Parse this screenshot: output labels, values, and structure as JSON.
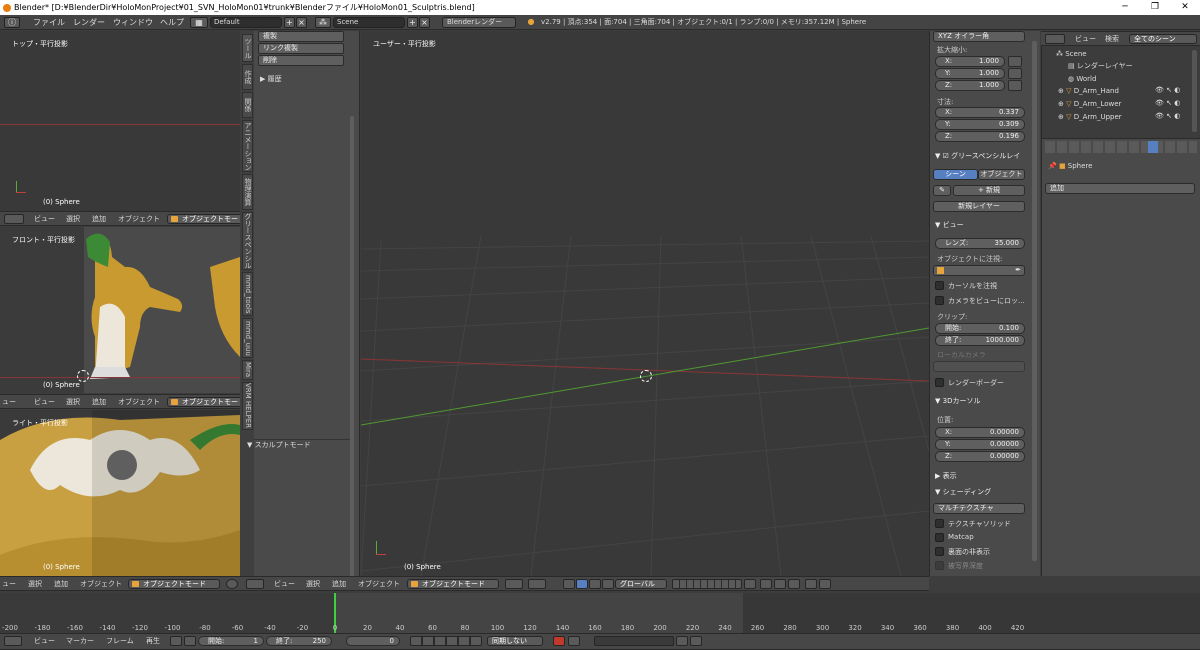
{
  "window": {
    "title": "Blender* [D:¥BlenderDir¥HoloMonProject¥01_SVN_HoloMon01¥trunk¥Blenderファイル¥HoloMon01_Sculptris.blend]",
    "minimize": "─",
    "maximize": "❐",
    "close": "✕"
  },
  "menubar": {
    "file": "ファイル",
    "render": "レンダー",
    "window": "ウィンドウ",
    "help": "ヘルプ",
    "screen_layout": "Default",
    "scene": "Scene",
    "engine": "Blenderレンダー",
    "stats": "v2.79 | 頂点:354 | 面:704 | 三角面:704 | オブジェクト:0/1 | ランプ:0/0 | メモリ:357.12M | Sphere"
  },
  "viewports": {
    "top": {
      "label": "トップ・平行投影",
      "object": "(0) Sphere"
    },
    "front": {
      "label": "フロント・平行投影",
      "object": "(0) Sphere"
    },
    "right": {
      "label": "ライト・平行投影",
      "object": "(0) Sphere"
    },
    "main": {
      "label": "ユーザー・平行投影",
      "object": "(0) Sphere"
    }
  },
  "small_header": {
    "view": "ビュー",
    "select": "選択",
    "add": "追加",
    "object": "オブジェクト",
    "mode": "オブジェクトモー",
    "view_cut": "ュー"
  },
  "main_header": {
    "view": "ビュー",
    "select": "選択",
    "add": "追加",
    "object": "オブジェクト",
    "mode": "オブジェクトモード",
    "orientation": "グローバル"
  },
  "toolshelf": {
    "tabs": [
      "ツール",
      "作成",
      "関係",
      "アニメーション",
      "物理演算",
      "グリースペンシル",
      "mmd_tools",
      "mmd_uuu",
      "Mira",
      "VRM HELPER"
    ],
    "buttons": [
      "複製",
      "リンク複製",
      "削除"
    ],
    "history": "履歴",
    "sculpt_mode": "スカルプトモード"
  },
  "properties": {
    "rotation_mode": "XYZ オイラー角",
    "scale_label": "拡大縮小:",
    "scale": [
      {
        "axis": "X:",
        "value": "1.000"
      },
      {
        "axis": "Y:",
        "value": "1.000"
      },
      {
        "axis": "Z:",
        "value": "1.000"
      }
    ],
    "dimensions_label": "寸法:",
    "dimensions": [
      {
        "axis": "X:",
        "value": "0.337"
      },
      {
        "axis": "Y:",
        "value": "0.309"
      },
      {
        "axis": "Z:",
        "value": "0.196"
      }
    ],
    "grease_pencil": {
      "title": "グリースペンシルレイ",
      "scene_tab": "シーン",
      "object_tab": "オブジェクト",
      "new": "新規",
      "new_layer": "新規レイヤー"
    },
    "view": {
      "title": "ビュー",
      "lens_label": "レンズ:",
      "lens_value": "35.000",
      "lock_to_object": "オブジェクトに注視:",
      "lock_to_cursor": "カーソルを注視",
      "lock_camera": "カメラをビューにロッ...",
      "clip_label": "クリップ:",
      "clip_start_label": "開始:",
      "clip_start": "0.100",
      "clip_end_label": "終了:",
      "clip_end": "1000.000",
      "local_camera": "ローカルカメラ",
      "render_border": "レンダーボーダー"
    },
    "cursor": {
      "title": "3Dカーソル",
      "location_label": "位置:",
      "location": [
        {
          "axis": "X:",
          "value": "0.00000"
        },
        {
          "axis": "Y:",
          "value": "0.00000"
        },
        {
          "axis": "Z:",
          "value": "0.00000"
        }
      ]
    },
    "display": {
      "title": "表示"
    },
    "shading": {
      "title": "シェーディング",
      "mode": "マルチテクスチャ",
      "textured_solid": "テクスチャソリッド",
      "matcap": "Matcap",
      "backface_culling": "裏面の非表示",
      "depth_of_field": "被写界深度"
    }
  },
  "outliner": {
    "view": "ビュー",
    "search": "検索",
    "filter": "全てのシーン",
    "items": [
      "Scene",
      "レンダーレイヤー",
      "World",
      "D_Arm_Hand",
      "D_Arm_Lower",
      "D_Arm_Upper"
    ]
  },
  "prop_editor": {
    "object_name": "Sphere",
    "add_menu": "追加"
  },
  "timeline": {
    "ticks": [
      "-200",
      "-180",
      "-160",
      "-140",
      "-120",
      "-100",
      "-80",
      "-60",
      "-40",
      "-20",
      "0",
      "20",
      "40",
      "60",
      "80",
      "100",
      "120",
      "140",
      "160",
      "180",
      "200",
      "220",
      "240",
      "260",
      "280",
      "300",
      "320",
      "340",
      "360",
      "380",
      "400",
      "420"
    ],
    "view": "ビュー",
    "marker": "マーカー",
    "frame": "フレーム",
    "playback": "再生",
    "start_label": "開始:",
    "start": "1",
    "end_label": "終了:",
    "end": "250",
    "current": "0",
    "sync": "同期しない"
  },
  "colors": {
    "accent_blue": "#5680c2",
    "x_axis": "#a83a3a",
    "y_axis": "#5ea83a",
    "playhead": "#3fcf3f",
    "object_orange": "#e8a33d"
  }
}
